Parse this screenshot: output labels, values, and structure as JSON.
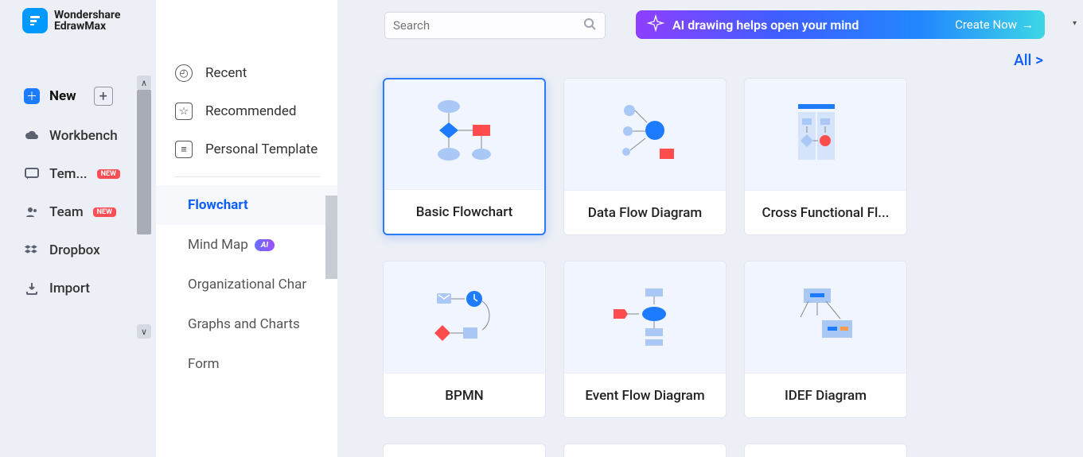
{
  "brand": {
    "line1": "Wondershare",
    "line2": "EdrawMax"
  },
  "nav": {
    "new": "New",
    "workbench": "Workbench",
    "templates": "Tem...",
    "team": "Team",
    "dropbox": "Dropbox",
    "import": "Import",
    "badge": "NEW"
  },
  "panel2": {
    "recent": "Recent",
    "recommended": "Recommended",
    "personal": "Personal Template",
    "categories": {
      "flowchart": "Flowchart",
      "mindmap": "Mind Map",
      "ai": "AI",
      "org": "Organizational Char",
      "graphs": "Graphs and Charts",
      "form": "Form"
    }
  },
  "search": {
    "placeholder": "Search"
  },
  "banner": {
    "text": "AI drawing helps open your mind",
    "cta": "Create Now"
  },
  "all": "All  >",
  "cards": {
    "basic": "Basic Flowchart",
    "dataflow": "Data Flow Diagram",
    "cross": "Cross Functional Fl...",
    "bpmn": "BPMN",
    "event": "Event Flow Diagram",
    "idef": "IDEF Diagram"
  }
}
